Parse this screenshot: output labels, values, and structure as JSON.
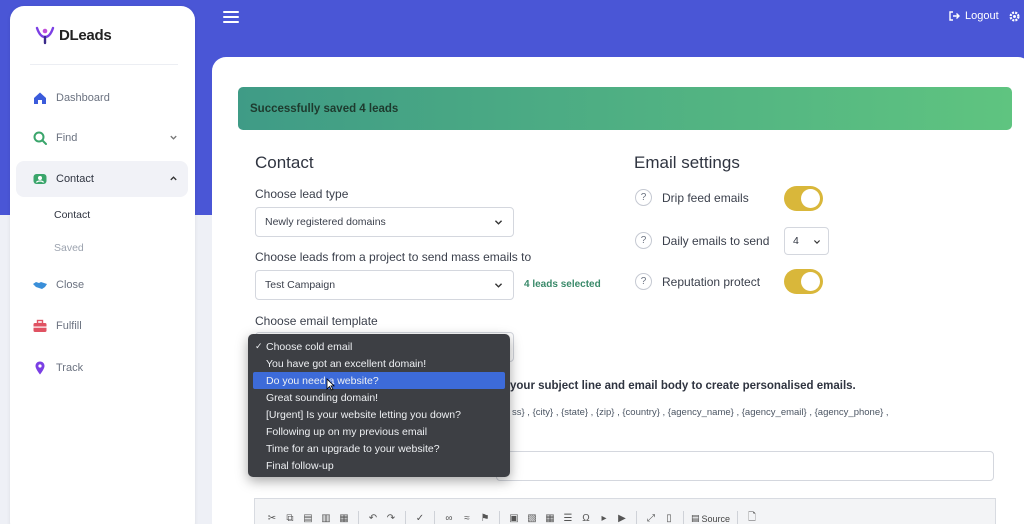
{
  "brand": {
    "name": "DLeads",
    "accent": "#4a56d6"
  },
  "header": {
    "logout_label": "Logout"
  },
  "sidebar": {
    "items": [
      {
        "label": "Dashboard",
        "icon": "home-icon"
      },
      {
        "label": "Find",
        "icon": "search-icon"
      },
      {
        "label": "Contact",
        "icon": "contact-icon"
      },
      {
        "label": "Close",
        "icon": "handshake-icon"
      },
      {
        "label": "Fulfill",
        "icon": "briefcase-icon"
      },
      {
        "label": "Track",
        "icon": "location-pin-icon"
      }
    ],
    "sub_items": [
      "Contact",
      "Saved"
    ]
  },
  "alert": {
    "text": "Successfully saved 4 leads"
  },
  "contact": {
    "title": "Contact",
    "lead_type_label": "Choose lead type",
    "lead_type_value": "Newly registered domains",
    "project_label": "Choose leads from a project to send mass emails to",
    "project_value": "Test Campaign",
    "leads_selected": "4 leads selected",
    "template_label": "Choose email template"
  },
  "email_settings": {
    "title": "Email settings",
    "drip_label": "Drip feed emails",
    "daily_label": "Daily emails to send",
    "daily_value": "4",
    "reputation_label": "Reputation protect",
    "help_glyph": "?"
  },
  "editor": {
    "hint": "your subject line and email body to create personalised emails.",
    "variables": "ss} ,  {city} ,  {state} ,  {zip} ,  {country} ,  {agency_name} ,  {agency_email} ,  {agency_phone} ,",
    "source_label": "Source"
  },
  "template_dropdown": {
    "options": [
      "Choose cold email",
      "You have got an excellent domain!",
      "Do you need a website?",
      "Great sounding domain!",
      "[Urgent] Is your website letting you down?",
      "Following up on my previous email",
      "Time for an upgrade to your website?",
      "Final follow-up"
    ],
    "checked_index": 0,
    "highlighted_index": 2
  }
}
